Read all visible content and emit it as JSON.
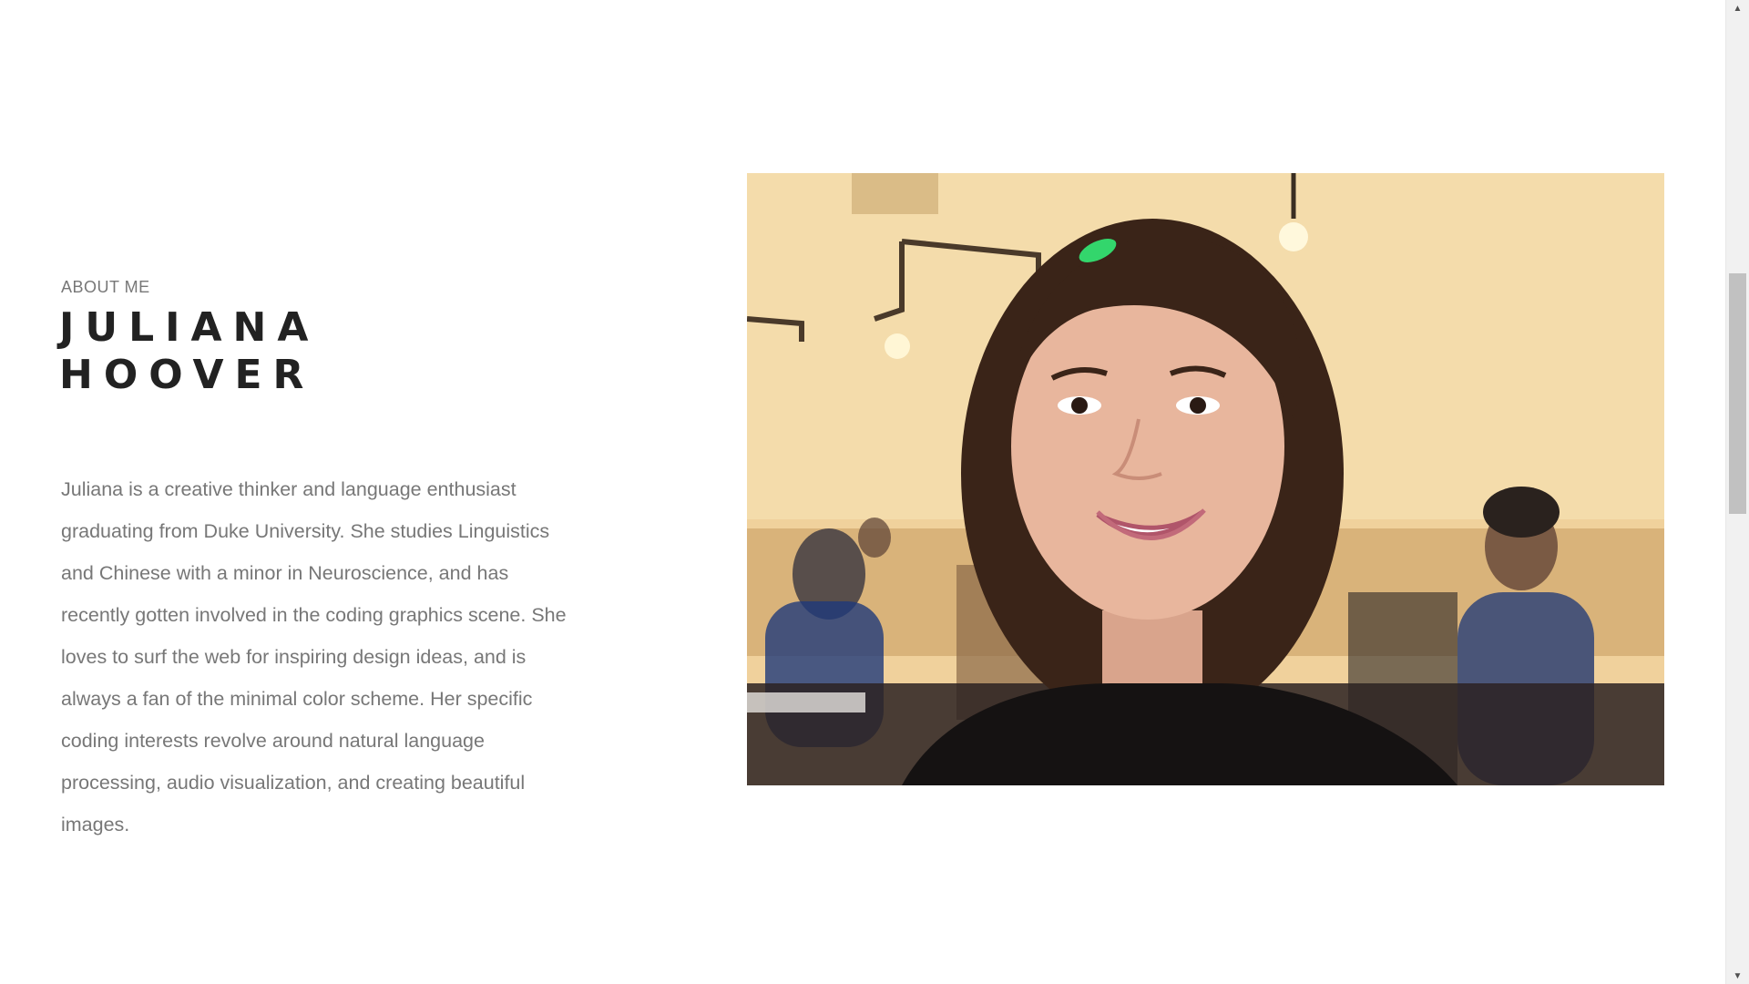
{
  "about": {
    "eyebrow": "ABOUT ME",
    "name": "JULIANA HOOVER",
    "bio": "Juliana is a creative thinker and language enthusiast graduating from Duke University. She studies Linguistics and Chinese with a minor in Neuroscience, and has recently gotten involved in the coding graphics scene. She loves to surf the web for inspiring design ideas, and is always a fan of the minimal color scheme. Her specific coding interests revolve around natural language processing, audio visualization, and creating beautiful images."
  },
  "photo": {
    "subject": "portrait photo of smiling woman in a cafe"
  },
  "colors": {
    "heading": "#222222",
    "body_text": "#777777",
    "background": "#ffffff"
  }
}
